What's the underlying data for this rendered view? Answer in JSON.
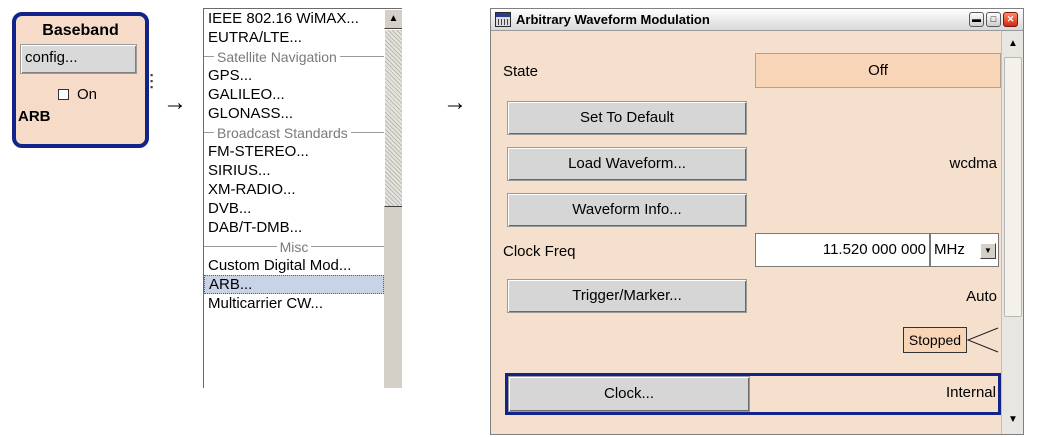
{
  "baseband": {
    "title": "Baseband",
    "config_label": "config...",
    "on_label": "On",
    "on_checked": false,
    "mode": "ARB"
  },
  "arrows": [
    "→",
    "→"
  ],
  "menu": {
    "items": [
      {
        "type": "item",
        "label": "IEEE 802.16 WiMAX..."
      },
      {
        "type": "item",
        "label": "EUTRA/LTE..."
      },
      {
        "type": "separator",
        "label": "Satellite Navigation"
      },
      {
        "type": "item",
        "label": "GPS..."
      },
      {
        "type": "item",
        "label": "GALILEO..."
      },
      {
        "type": "item",
        "label": "GLONASS..."
      },
      {
        "type": "separator",
        "label": "Broadcast Standards"
      },
      {
        "type": "item",
        "label": "FM-STEREO..."
      },
      {
        "type": "item",
        "label": "SIRIUS..."
      },
      {
        "type": "item",
        "label": "XM-RADIO..."
      },
      {
        "type": "item",
        "label": "DVB..."
      },
      {
        "type": "item",
        "label": "DAB/T-DMB..."
      },
      {
        "type": "separator",
        "label": "Misc"
      },
      {
        "type": "item",
        "label": "Custom Digital Mod..."
      },
      {
        "type": "item",
        "label": "ARB...",
        "selected": true
      },
      {
        "type": "item",
        "label": "Multicarrier CW..."
      }
    ]
  },
  "dialog": {
    "title": "Arbitrary Waveform Modulation",
    "state_label": "State",
    "state_value": "Off",
    "set_default_label": "Set To Default",
    "load_waveform_label": "Load Waveform...",
    "waveform_value": "wcdma",
    "waveform_info_label": "Waveform Info...",
    "clock_freq_label": "Clock Freq",
    "clock_freq_value": "11.520 000 000",
    "clock_freq_unit": "MHz",
    "trigger_label": "Trigger/Marker...",
    "trigger_value": "Auto",
    "status": "Stopped",
    "clock_label": "Clock...",
    "clock_value": "Internal"
  },
  "colors": {
    "panel_bg": "#f5dfcd",
    "field_bg": "#f8d5b7",
    "accent_border": "#12238a",
    "selected_item": "#c9d3e6"
  }
}
